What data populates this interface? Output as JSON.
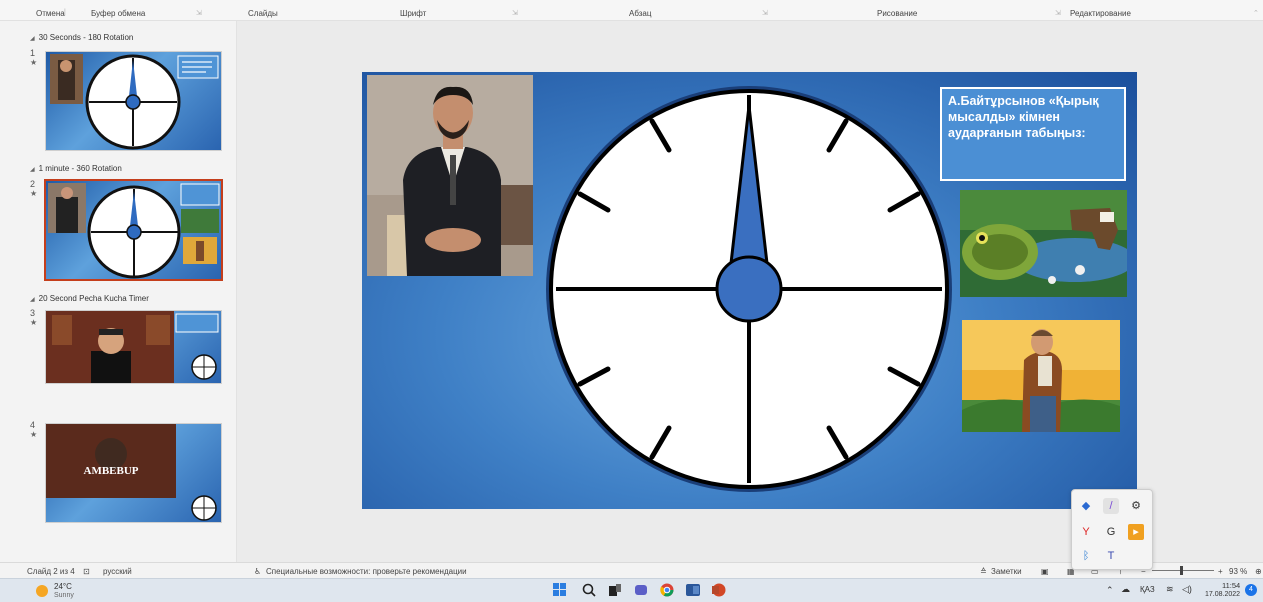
{
  "ribbon": {
    "groups": [
      "Отмена",
      "Буфер обмена",
      "Слайды",
      "Шрифт",
      "Абзац",
      "Рисование",
      "Редактирование"
    ]
  },
  "thumbnails_pane": {
    "sections": [
      {
        "title": "30 Seconds - 180 Rotation"
      },
      {
        "title": "1 minute - 360 Rotation"
      },
      {
        "title": "20 Second Pecha Kucha Timer"
      }
    ],
    "slides": [
      {
        "number": "1",
        "star": "★"
      },
      {
        "number": "2",
        "star": "★"
      },
      {
        "number": "3",
        "star": "★"
      },
      {
        "number": "4",
        "star": "★"
      }
    ],
    "slide4_logo": "AMBEBUP"
  },
  "slide": {
    "question": "А.Байтұрсынов «Қырық мысалды» кімнен аударғанын табыңыз:"
  },
  "status_bar": {
    "slide_counter": "Слайд 2 из 4",
    "language": "русский",
    "accessibility": "Специальные возможности: проверьте рекомендации",
    "notes": "Заметки",
    "zoom": "93 %"
  },
  "taskbar": {
    "weather_temp": "24°C",
    "weather_desc": "Sunny",
    "lang": "ҚАЗ",
    "time": "11:54",
    "date": "17.08.2022",
    "notifications": "4"
  },
  "colors": {
    "accent": "#c43e1c",
    "slide_blue": "#3f80c6",
    "hand_blue": "#3a6fc0"
  }
}
